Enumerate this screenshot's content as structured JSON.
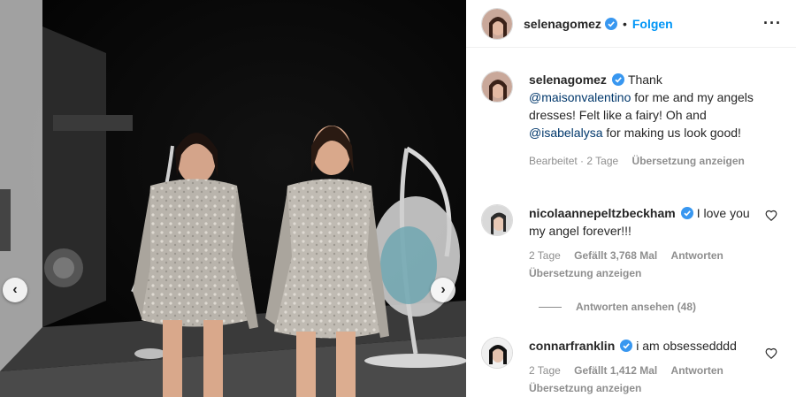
{
  "post": {
    "author": "selenagomez",
    "follow_label": "Folgen",
    "dot": "•",
    "more": "···",
    "nav_prev": "‹",
    "nav_next": "›"
  },
  "caption": {
    "username": "selenagomez",
    "text_1": "Thank ",
    "mention_1": "@maisonvalentino",
    "text_2": " for me and my angels dresses! Felt like a fairy! Oh and ",
    "mention_2": "@isabelalysa",
    "text_3": " for making us look good!",
    "edited": "Bearbeitet",
    "time": "2 Tage",
    "translate": "Übersetzung anzeigen",
    "meta_sep": " · "
  },
  "comments": [
    {
      "username": "nicolaannepeltzbeckham",
      "text": "I love you my angel forever!!!",
      "time": "2 Tage",
      "likes": "Gefällt 3,768 Mal",
      "reply": "Antworten",
      "translate": "Übersetzung anzeigen",
      "view_replies": "Antworten ansehen (48)"
    },
    {
      "username": "connarfranklin",
      "text": "i am obsessedddd",
      "time": "2 Tage",
      "likes": "Gefällt 1,412 Mal",
      "reply": "Antworten",
      "translate": "Übersetzung anzeigen"
    }
  ],
  "colors": {
    "link": "#0095f6",
    "mention": "#00376b",
    "verified": "#3897f0",
    "muted": "#8e8e8e"
  },
  "icons": {
    "verified": "verified-badge-icon",
    "heart": "heart-outline-icon",
    "more": "more-options-icon",
    "prev": "chevron-left-icon",
    "next": "chevron-right-icon"
  }
}
